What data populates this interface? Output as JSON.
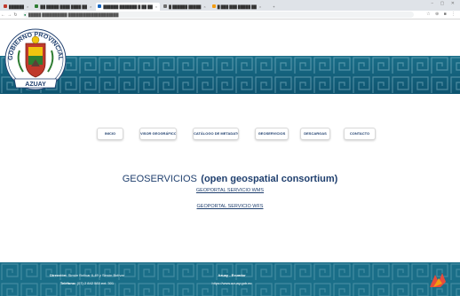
{
  "browser": {
    "tabs": [
      {
        "label": "██████",
        "favicon_color": "#c0392b"
      },
      {
        "label": "██ █████ ████ ████ ██",
        "favicon_color": "#2e7d32"
      },
      {
        "label": "██████ ███████ █ ██ ██",
        "favicon_color": "#1565c0",
        "active": true
      },
      {
        "label": "█ ██████ █████",
        "favicon_color": "#6d6d6d"
      },
      {
        "label": "█ ███ ███ █████ ██",
        "favicon_color": "#f39c12"
      }
    ],
    "url": "█████ ██████████ ████████████████████"
  },
  "banner": {
    "seal_text_top": "GOBIERNO PROVINCIAL",
    "seal_text_bottom": "AZUAY"
  },
  "menu": [
    {
      "label": "INICIO"
    },
    {
      "label": "VISOR GEOGRÁFICO"
    },
    {
      "label": "CATÁLOGO DE METADATOS"
    },
    {
      "label": "GEOSERVICIOS"
    },
    {
      "label": "DESCARGAS"
    },
    {
      "label": "CONTACTO"
    }
  ],
  "content": {
    "title_main": "GEOSERVICIOS",
    "title_sub": "(open geospatial consortium)",
    "links": [
      {
        "label": "GEOPORTAL SERVICIO WMS"
      },
      {
        "label": "GEOPORTAL SERVICIO WFS"
      }
    ]
  },
  "footer": {
    "address_label": "Dirección:",
    "address": "Simón Bolívar 6-49 y Simón Bolívar",
    "phone_label": "Teléfono:",
    "phone": "(07) 2 842 588 ext. 301",
    "org": "Azuay - Ecuador",
    "website": "https://www.azuay.gob.ec"
  },
  "colors": {
    "banner": "#1a6e88",
    "menu_text": "#1f3f6e",
    "footer": "#1a6e88",
    "seal_red": "#c0392b"
  }
}
